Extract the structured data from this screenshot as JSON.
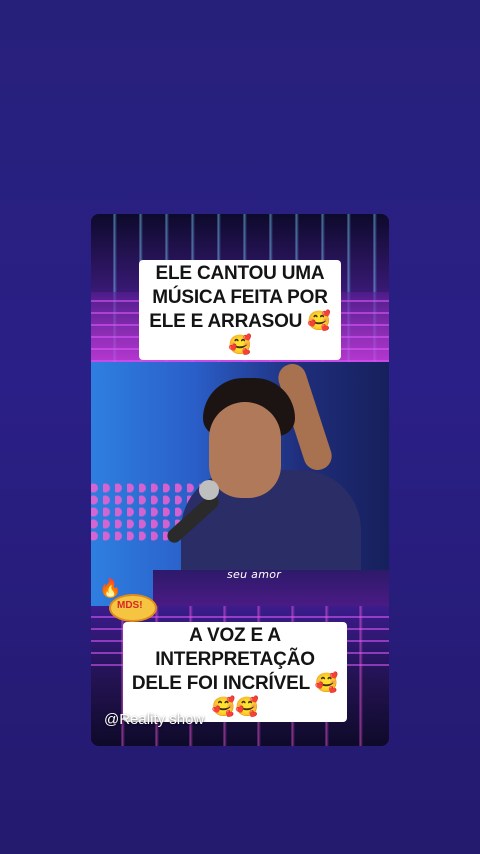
{
  "post": {
    "caption_top_lines": [
      "ELE CANTOU UMA",
      "MÚSICA FEITA POR",
      "ELE E ARRASOU 🥰🥰"
    ],
    "caption_bottom_lines": [
      "A VOZ E A",
      "INTERPRETAÇÃO",
      "DELE FOI INCRÍVEL 🥰",
      "🥰🥰"
    ],
    "lyric_text": "seu amor",
    "sticker_text": "MDS!",
    "watermark": "@Reality show"
  },
  "colors": {
    "background": "#27207a",
    "caption_bg": "#ffffff",
    "caption_text": "#141414",
    "sticker_bg": "#f5c542",
    "sticker_text": "#d4282a"
  },
  "icons": {
    "sticker": "fire-icon"
  }
}
